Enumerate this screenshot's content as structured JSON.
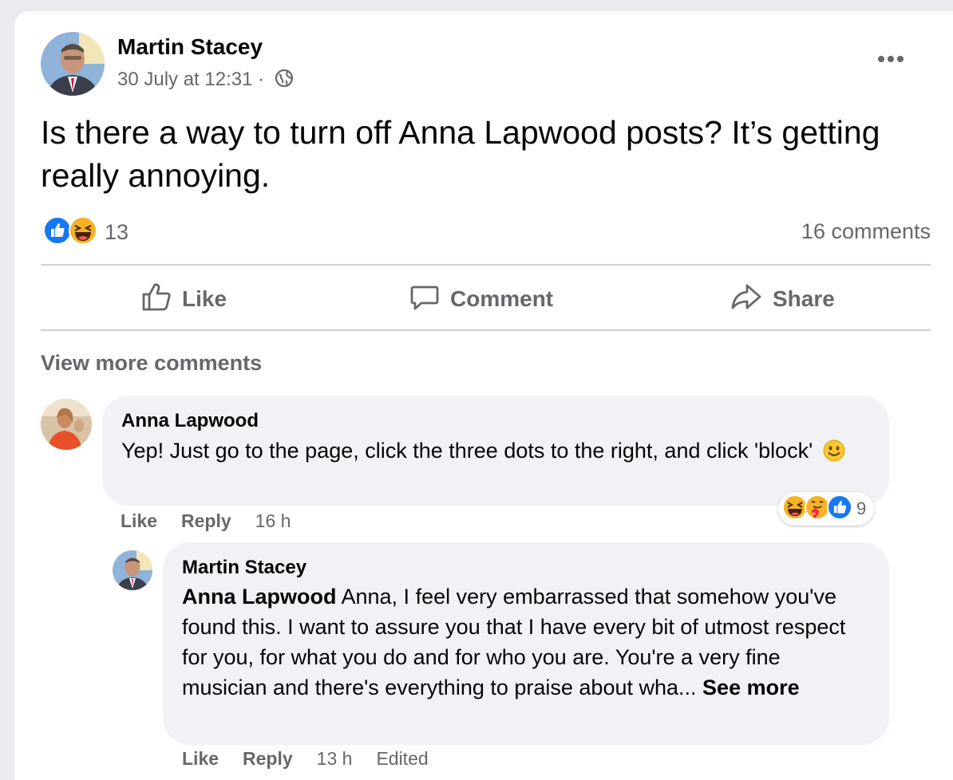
{
  "post": {
    "author": "Martin Stacey",
    "timestamp": "30 July at 12:31",
    "separator": "·",
    "audience_icon": "globe-icon",
    "text": "Is there a way to turn off Anna Lapwood posts? It’s getting really annoying.",
    "reaction_icons": [
      "like-icon",
      "haha-icon"
    ],
    "reaction_count": "13",
    "comments_count": "16 comments"
  },
  "actions": {
    "like": "Like",
    "comment": "Comment",
    "share": "Share"
  },
  "view_more_comments": "View more comments",
  "comments": [
    {
      "author": "Anna Lapwood",
      "text": "Yep! Just go to the page, click the three dots to the right, and click 'block'",
      "emoji": "slightly-smiling-face-icon",
      "like_label": "Like",
      "reply_label": "Reply",
      "time": "16 h",
      "reaction_icons": [
        "haha-icon",
        "care-icon",
        "like-icon"
      ],
      "reaction_count": "9"
    },
    {
      "author": "Martin Stacey",
      "mention": "Anna Lapwood",
      "text": "Anna, I feel very embarrassed that somehow you've found this. I want to assure you that I have every bit of utmost respect for you, for what you do and for who you are. You're a very fine musician and there's everything to praise about wha...",
      "see_more": "See more",
      "like_label": "Like",
      "reply_label": "Reply",
      "time": "13 h",
      "edited": "Edited"
    }
  ],
  "colors": {
    "like_blue": "#1877f2",
    "haha_yellow": "#f7b125",
    "secondary_text": "#65676b",
    "bubble_bg": "#f0f2f5"
  }
}
